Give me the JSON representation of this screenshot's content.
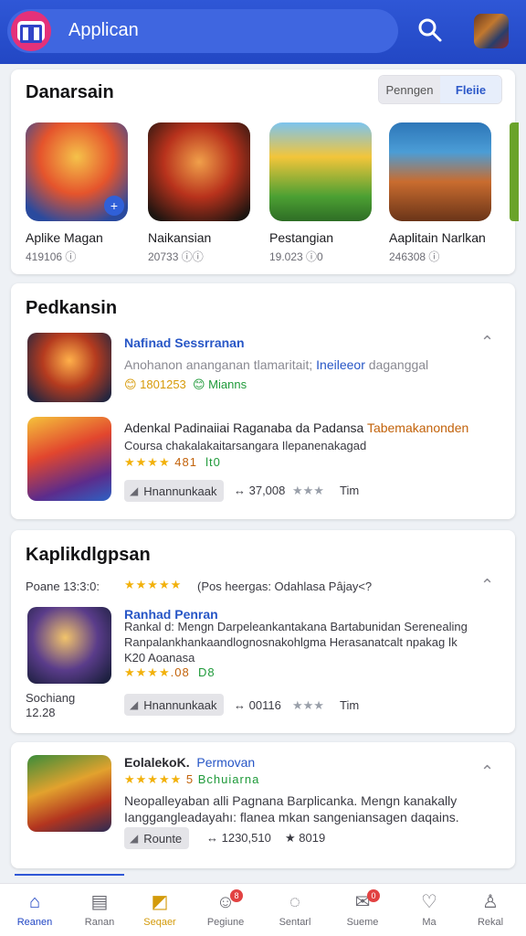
{
  "app": {
    "title": "Applican"
  },
  "section_featured": {
    "title": "Danarsain",
    "toggle": [
      "Penngen",
      "Fleiie"
    ],
    "items": [
      {
        "name": "Aplike Magan",
        "meta": "419106 ⓘ"
      },
      {
        "name": "Naikansian",
        "meta": "20733 ⓘⓘ"
      },
      {
        "name": "Pestangian",
        "meta": "19.023 ⓘ0"
      },
      {
        "name": "Aaplitain Narlkan",
        "meta": "246308 ⓘ"
      }
    ]
  },
  "section_2": {
    "title": "Pedkansin",
    "rows": [
      {
        "title": "Nafinad Sessrranan",
        "desc_a": "Anohanon ananganan tlamaritait; ",
        "desc_b": "Ineileeor",
        "desc_c": " daganggal",
        "meta_a": "😊 1801253",
        "meta_b": "😊 Mianns"
      },
      {
        "line1_a": "Adenkal Padinaiiai Raganaba da Padansa ",
        "line1_b": "Tabemakanonden",
        "line2": "Coursa chakalakaitarsangara Ilepanenakagad",
        "stars": "★★★★ ",
        "rating": "481",
        "rating_b": "lt0",
        "chip": "Hnannunkaak",
        "downloads": "↔ 37,008",
        "stars_b": "★★★",
        "link": "Tim"
      }
    ]
  },
  "section_3": {
    "title": "Kaplikdlgpsan",
    "meta_row": {
      "date": "Poane 13:3:0:",
      "stars": "★★★★★",
      "text": "(Pos heergas:  Odahlasa Pâjay<?"
    },
    "row": {
      "title": "Ranhad Penran",
      "line1": "Rankal d: Mengn Darpeleankantakana Bartabunidan Serenealing",
      "line2": "Ranpalankhankaandlognosnakohlgma Herasanatcalt npakag ǀk",
      "line3": "K20 Aoanasa",
      "stars": "★★★★",
      "rating": ".08",
      "rating_b": "D8",
      "side_a": "Sochiang",
      "side_b": "12.28",
      "chip": "Hnannunkaak",
      "downloads": "↔ 00116",
      "stars_b": "★★★",
      "link": "Tim"
    }
  },
  "section_4": {
    "title_a": "EolalekoK.",
    "title_b": "Permovan",
    "stars": "★★★★★",
    "stars_text": "Bchuiarna",
    "stars_num": "5",
    "line1": "Neopalleyaban alli Pagnana Barplicanka. Mengn kanakally",
    "line2": "Ianggangleadayahı: flanea mkan sangeniansagen daqains.",
    "chip": "Rounte",
    "downloads": "↔ 1230,510",
    "score": "★ 8019"
  },
  "bottom_nav": [
    {
      "label": "Reanen",
      "icon": "home-icon",
      "glyph": "⌂"
    },
    {
      "label": "Ranan",
      "icon": "store-icon",
      "glyph": "▤"
    },
    {
      "label": "Seqaer",
      "icon": "games-icon",
      "glyph": "◩"
    },
    {
      "label": "Pegiune",
      "icon": "gamepad-icon",
      "glyph": "☺",
      "badge": "8"
    },
    {
      "label": "Sentarl",
      "icon": "chat-icon",
      "glyph": "◌"
    },
    {
      "label": "Sueme",
      "icon": "messages-icon",
      "glyph": "✉",
      "badge": "0"
    },
    {
      "label": "Ma",
      "icon": "heart-icon",
      "glyph": "♡"
    },
    {
      "label": "Rekal",
      "icon": "profile-icon",
      "glyph": "♙"
    }
  ],
  "colors": {
    "accent": "#2247c4",
    "link": "#2756c6",
    "star": "#f2b10b",
    "logo": "#e4317a"
  }
}
